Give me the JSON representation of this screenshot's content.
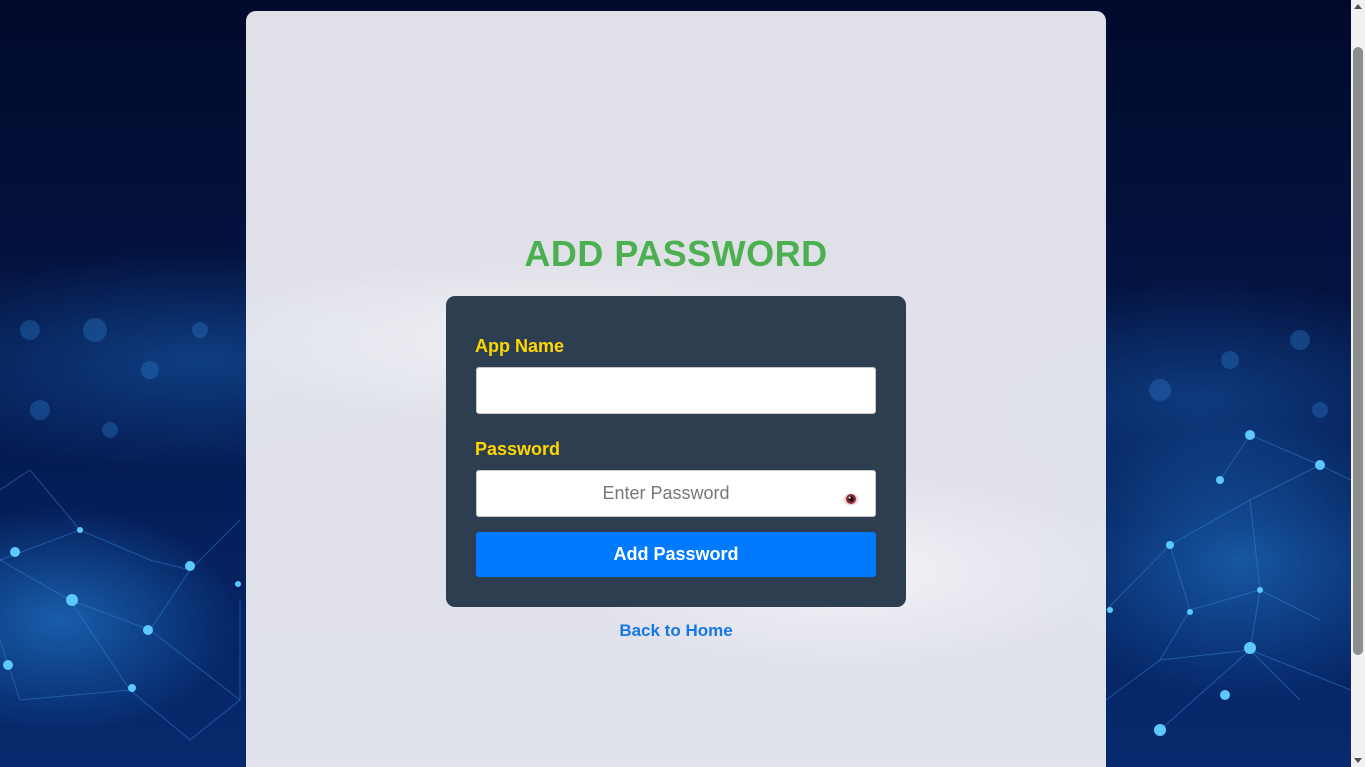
{
  "page": {
    "title": "ADD PASSWORD",
    "background_theme": "blue-network"
  },
  "form": {
    "app_name_label": "App Name",
    "app_name_value": "",
    "password_label": "Password",
    "password_placeholder": "Enter Password",
    "password_value": "",
    "toggle_icon": "eye-icon",
    "submit_label": "Add Password"
  },
  "links": {
    "back_home": "Back to Home"
  },
  "colors": {
    "title": "#4caf50",
    "label": "#ffd700",
    "card": "#2c3e50",
    "button": "#007bff",
    "link": "#1677e6"
  }
}
